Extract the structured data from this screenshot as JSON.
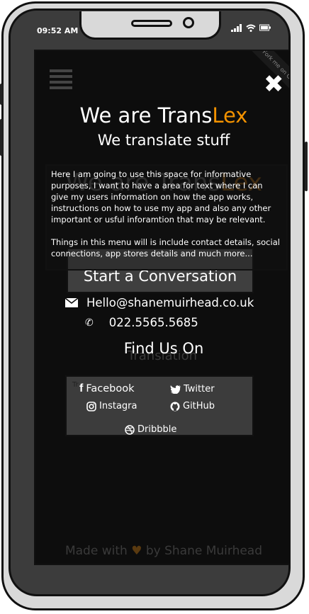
{
  "status_bar": {
    "time": "09:52 AM",
    "icons": [
      "signal-icon",
      "wifi-icon",
      "battery-icon"
    ]
  },
  "menu": {
    "ribbon_text": "Fork me on GitHub",
    "close_symbol": "✖",
    "title_prefix": "We are Trans",
    "title_accent": "Lex",
    "subtitle": "We translate stuff",
    "background_title_prefix": "We are Trans",
    "background_title_accent": "Lex",
    "info_paragraph_1": "Here I am going to use this space for informative purposes, I want to have a area for text where I can give my users information on how the app works, instructions on how to use my app and also any other important or usful inforamtion that may be relevant.",
    "info_paragraph_2": "Things in this menu will is include contact details, social connections, app stores details and much more...",
    "conversation_button": "Start a Conversation",
    "email": "Hello@shanemuirhead.co.uk",
    "phone": "022.5565.5685",
    "find_us": "Find Us On",
    "background_translation": "Translation",
    "background_tr": "Tr",
    "social": {
      "facebook": "Facebook",
      "twitter": "Twitter",
      "instagram": "Instagra",
      "github": "GitHub",
      "dribbble": "Dribbble"
    },
    "footer_prefix": "Made with",
    "footer_suffix": "by Shane Muirhead"
  },
  "colors": {
    "accent": "#f39200",
    "screen_bg": "#0d0d0d",
    "panel_bg": "#3c3c3c"
  }
}
